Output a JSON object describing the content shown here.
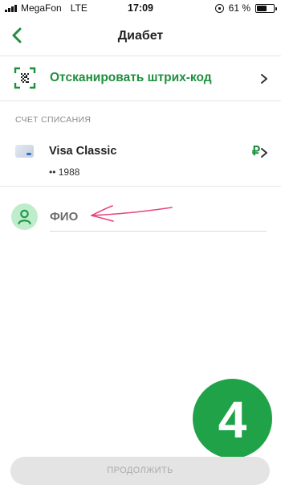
{
  "status_bar": {
    "carrier": "MegaFon",
    "network": "LTE",
    "time": "17:09",
    "battery_percent": "61 %",
    "battery_level": 0.61
  },
  "nav": {
    "title": "Диабет",
    "back_icon": "chevron-left-icon"
  },
  "scan": {
    "label": "Отсканировать штрих-код",
    "icon": "barcode-scan-icon"
  },
  "account_section": {
    "label": "СЧЕТ СПИСАНИЯ",
    "account": {
      "name": "Visa Classic",
      "number": "•• 1988",
      "currency_symbol": "₽"
    }
  },
  "fio": {
    "placeholder": "ФИО",
    "icon": "person-icon"
  },
  "step_badge": "4",
  "continue_button": "ПРОДОЛЖИТЬ",
  "colors": {
    "accent": "#1f8f3f",
    "badge": "#20a348",
    "arrow": "#e8457a",
    "avatar_bg": "#bfeccb"
  }
}
